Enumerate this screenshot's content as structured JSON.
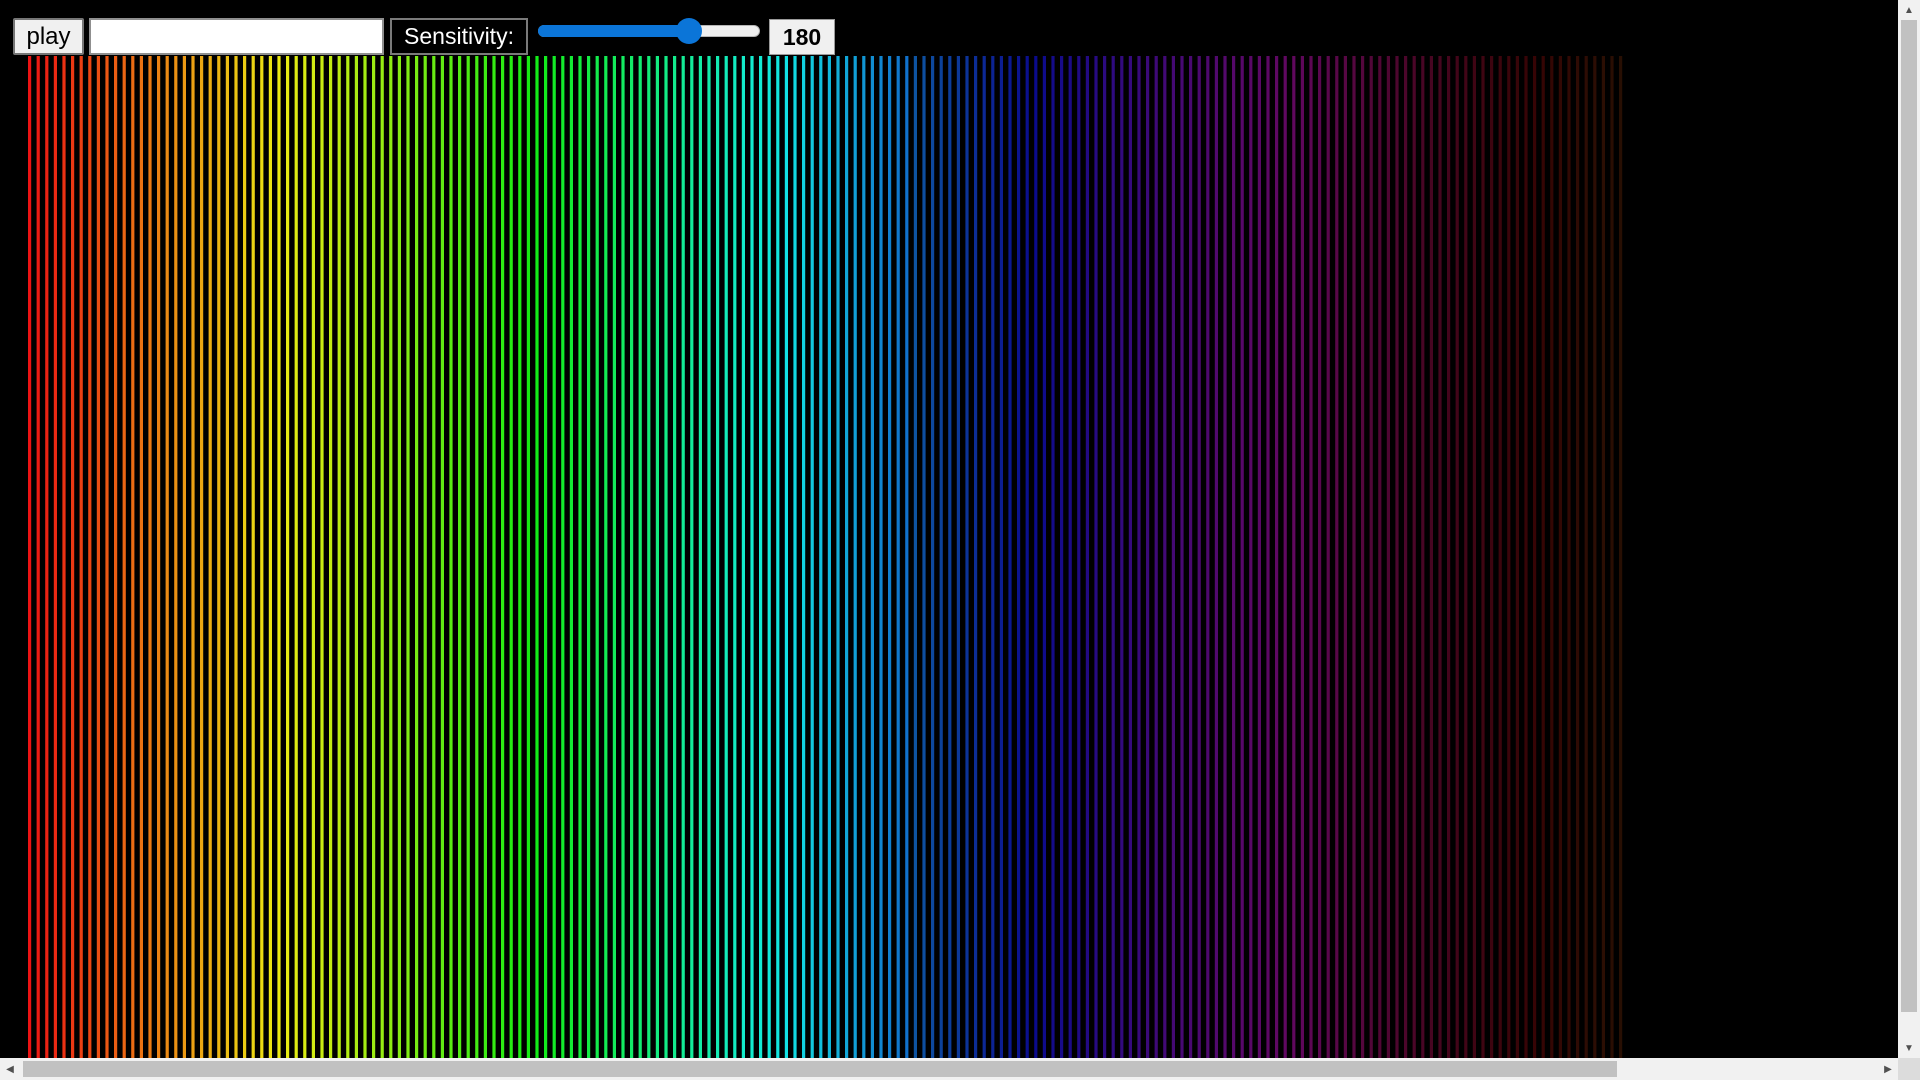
{
  "toolbar": {
    "play_label": "play",
    "text_input_value": "",
    "sensitivity_label": "Sensitivity:",
    "sensitivity_value": "180",
    "slider_fraction": 0.68,
    "slider_color": "#0b75d8"
  },
  "visualizer": {
    "background": "#000000",
    "bar_colors_note_icon": "spectrum-bars"
  },
  "scrollbars": {
    "up_icon": "arrow-up-icon",
    "down_icon": "arrow-down-icon",
    "left_icon": "arrow-left-icon",
    "right_icon": "arrow-right-icon"
  }
}
